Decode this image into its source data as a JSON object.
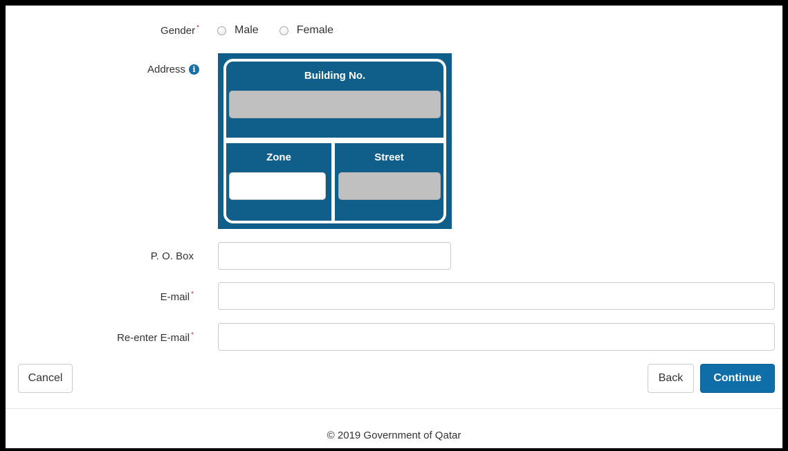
{
  "gender": {
    "label": "Gender",
    "required_mark": "*",
    "options": [
      {
        "label": "Male",
        "selected": false
      },
      {
        "label": "Female",
        "selected": false
      }
    ]
  },
  "address": {
    "label": "Address",
    "info_icon": "info-circle-icon",
    "info_glyph": "i",
    "building_label": "Building No.",
    "building_value": "",
    "zone_label": "Zone",
    "zone_value": "",
    "street_label": "Street",
    "street_value": ""
  },
  "po_box": {
    "label": "P. O. Box",
    "value": ""
  },
  "email": {
    "label": "E-mail",
    "required_mark": "*",
    "value": ""
  },
  "email_confirm": {
    "label": "Re-enter E-mail",
    "required_mark": "*",
    "value": ""
  },
  "actions": {
    "cancel_label": "Cancel",
    "back_label": "Back",
    "continue_label": "Continue"
  },
  "footer": {
    "text": "© 2019 Government of Qatar"
  },
  "colors": {
    "primary": "#0f6ea8",
    "plate": "#0f5f8a",
    "required": "#c9302c",
    "disabled_field": "#c0c0c0"
  }
}
